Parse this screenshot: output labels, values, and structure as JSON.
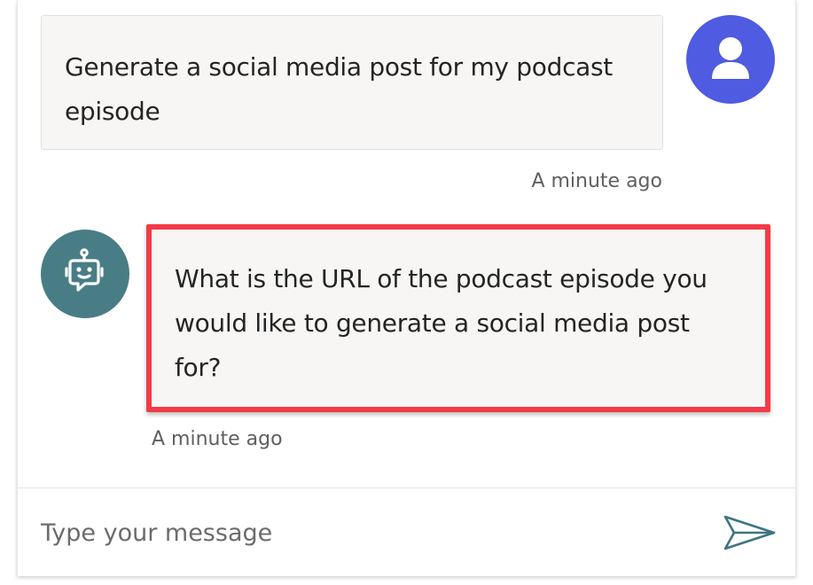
{
  "conversation": {
    "user_message": {
      "text": "Generate a social media post for my podcast episode",
      "timestamp": "A minute ago"
    },
    "bot_message": {
      "text": "What is the URL of the podcast episode you would like to generate a social media post for?",
      "timestamp": "A minute ago",
      "highlighted": true
    }
  },
  "composer": {
    "placeholder": "Type your message",
    "value": ""
  },
  "icons": {
    "user_avatar": "person-icon",
    "bot_avatar": "robot-icon",
    "send": "send-icon"
  },
  "colors": {
    "user_avatar_bg": "#4f5be0",
    "bot_avatar_bg": "#497d86",
    "highlight_border": "#f43a47",
    "bubble_bg": "#f7f6f5",
    "send_icon": "#3c7580"
  }
}
